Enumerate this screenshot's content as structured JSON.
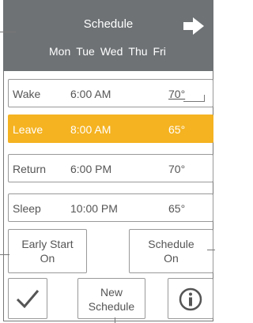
{
  "header": {
    "title": "Schedule",
    "days": [
      "Mon",
      "Tue",
      "Wed",
      "Thu",
      "Fri"
    ]
  },
  "rows": [
    {
      "label": "Wake",
      "time": "6:00 AM",
      "temp": "70°",
      "active": false
    },
    {
      "label": "Leave",
      "time": "8:00 AM",
      "temp": "65°",
      "active": true
    },
    {
      "label": "Return",
      "time": "6:00 PM",
      "temp": "70°",
      "active": false
    },
    {
      "label": "Sleep",
      "time": "10:00 PM",
      "temp": "65°",
      "active": false
    }
  ],
  "buttons": {
    "early_start": {
      "line1": "Early Start",
      "line2": "On"
    },
    "schedule": {
      "line1": "Schedule",
      "line2": "On"
    },
    "new_schedule": {
      "line1": "New",
      "line2": "Schedule"
    }
  },
  "icons": {
    "next": "arrow-right-icon",
    "confirm": "check-icon",
    "info": "info-icon"
  },
  "colors": {
    "header_bg": "#6e7275",
    "active_row": "#f5b321"
  }
}
